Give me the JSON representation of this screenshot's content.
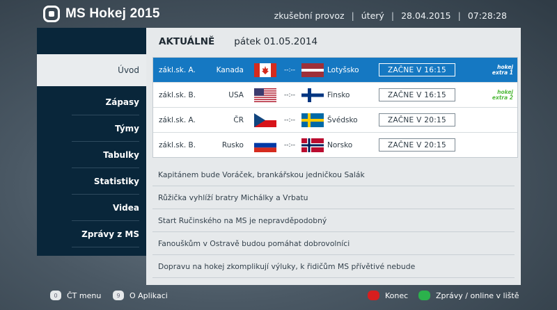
{
  "header": {
    "title": "MS Hokej 2015",
    "mode": "zkušební provoz",
    "day": "úterý",
    "date": "28.04.2015",
    "time": "07:28:28"
  },
  "sidebar": {
    "items": [
      {
        "label": "Úvod"
      },
      {
        "label": "Zápasy"
      },
      {
        "label": "Týmy"
      },
      {
        "label": "Tabulky"
      },
      {
        "label": "Statistiky"
      },
      {
        "label": "Videa"
      },
      {
        "label": "Zprávy z MS"
      }
    ]
  },
  "panel": {
    "heading": "AKTUÁLNĚ",
    "date": "pátek 01.05.2014"
  },
  "matches": [
    {
      "group": "zákl.sk. A.",
      "home": "Kanada",
      "score": "--:--",
      "away": "Lotyšsko",
      "start": "ZAČNE V 16:15",
      "channel_line1": "hokej",
      "channel_line2": "extra 1",
      "home_flag": "canada-flag",
      "away_flag": "latvia-flag"
    },
    {
      "group": "zákl.sk. B.",
      "home": "USA",
      "score": "--:--",
      "away": "Finsko",
      "start": "ZAČNE V 16:15",
      "channel_line1": "hokej",
      "channel_line2": "extra 2",
      "home_flag": "usa-flag",
      "away_flag": "finland-flag"
    },
    {
      "group": "zákl.sk. A.",
      "home": "ČR",
      "score": "--:--",
      "away": "Švédsko",
      "start": "ZAČNE V 20:15",
      "home_flag": "czech-flag",
      "away_flag": "sweden-flag"
    },
    {
      "group": "zákl.sk. B.",
      "home": "Rusko",
      "score": "--:--",
      "away": "Norsko",
      "start": "ZAČNE V 20:15",
      "home_flag": "russia-flag",
      "away_flag": "norway-flag"
    }
  ],
  "news": [
    "Kapitánem bude Voráček, brankářskou jedničkou Salák",
    "Růžička vyhlíží bratry Michálky a Vrbatu",
    "Start Ručinského na MS je nepravděpodobný",
    "Fanouškům v Ostravě budou pomáhat dobrovolníci",
    "Dopravu na hokej zkomplikují výluky, k řidičům MS přívětivé nebude"
  ],
  "footer": {
    "key0": "0",
    "key0_label": "ČT menu",
    "key9": "9",
    "key9_label": "O Aplikaci",
    "red_label": "Konec",
    "green_label": "Zprávy / online v liště"
  },
  "colors": {
    "accent": "#1578c2",
    "sidebar": "#09263a",
    "red_key": "#d81e1e",
    "green_key": "#2bb24c"
  }
}
